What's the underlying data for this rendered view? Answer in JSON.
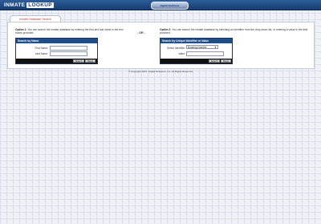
{
  "header": {
    "logo_part1": "INMATE",
    "logo_part2": "LOOKUP",
    "brand": "Digital Solutions"
  },
  "tab": {
    "label": "Inmate Database Search"
  },
  "option1": {
    "title": "Option 1:",
    "text": "You can search the inmate database by entering the first and last name in the text boxes provided."
  },
  "or_label": "- OR -",
  "option2": {
    "title": "Option 2:",
    "text": "You can search the inmate database by selecting an identifier from the drop down list, or entering a value in the field provided."
  },
  "name_search": {
    "title": "Search by Name",
    "first_name_label": "First Name:",
    "first_name_value": "",
    "last_name_label": "Last Name:",
    "last_name_value": "",
    "search_button": "Search",
    "reset_button": "Reset"
  },
  "id_search": {
    "title": "Search by Unique Identifier or Value",
    "identifier_label": "Select Identifier:",
    "identifier_selected": "Booking Number",
    "value_label": "Value:",
    "value_value": "",
    "search_button": "Search",
    "reset_button": "Reset"
  },
  "footer": {
    "copyright": "© Copyright 2007, Digital Solutions, Inc. All Rights Reserved"
  },
  "colors": {
    "header": "#1b4a86",
    "box_head": "#1f4e8d",
    "tab_text": "#c0392b"
  }
}
